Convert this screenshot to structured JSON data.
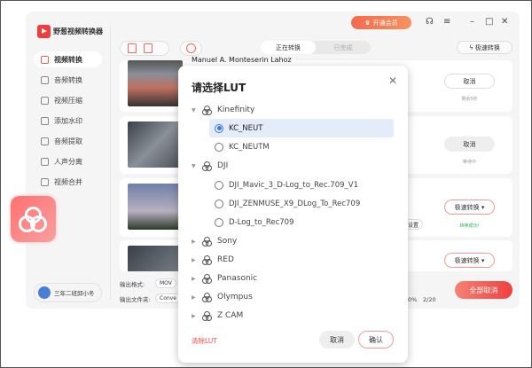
{
  "app": {
    "title": "野葱视频转换器",
    "vip_label": "开通会员",
    "user_name": "三年二班邱小冬"
  },
  "sidebar": {
    "items": [
      {
        "label": "视频转换"
      },
      {
        "label": "音频转换"
      },
      {
        "label": "视频压缩"
      },
      {
        "label": "添加水印"
      },
      {
        "label": "音频提取"
      },
      {
        "label": "人声分离"
      },
      {
        "label": "视频合并"
      }
    ]
  },
  "toolbar": {
    "tabs": [
      "正在转换",
      "已完成"
    ],
    "fast_convert": "极速转换"
  },
  "tasks": [
    {
      "name": "Manuel A. Monteserin Lahoz",
      "button": "取消",
      "status": "剩余5秒"
    },
    {
      "name": "",
      "button": "取消",
      "status": "等待中"
    },
    {
      "name": "",
      "button": "极速转换",
      "status": "转换成功!",
      "settings": "设置"
    },
    {
      "name": "",
      "button": "极速转换",
      "status": ""
    }
  ],
  "footer": {
    "format_label": "输出格式:",
    "format_value": "MOV",
    "folder_label": "输出文件夹:",
    "folder_value": "Conve",
    "progress": "0%",
    "count": "2/20",
    "cancel_all": "全部取消"
  },
  "colors": {
    "accent": "#f0403f",
    "selected": "#3b78e7",
    "success": "#2bb24c"
  },
  "dialog": {
    "title": "请选择LUT",
    "groups": [
      {
        "name": "Kinefinity",
        "expanded": true,
        "options": [
          "KC_NEUT",
          "KC_NEUTM"
        ]
      },
      {
        "name": "DJI",
        "expanded": true,
        "options": [
          "DJI_Mavic_3_D-Log_to_Rec.709_V1",
          "DJI_ZENMUSE_X9_DLog_To_Rec709",
          "D-Log_to_Rec709"
        ]
      },
      {
        "name": "Sony"
      },
      {
        "name": "RED"
      },
      {
        "name": "Panasonic"
      },
      {
        "name": "Olympus"
      },
      {
        "name": "Z CAM"
      }
    ],
    "selected": "KC_NEUT",
    "clear": "清除LUT",
    "cancel": "取消",
    "confirm": "确认"
  }
}
